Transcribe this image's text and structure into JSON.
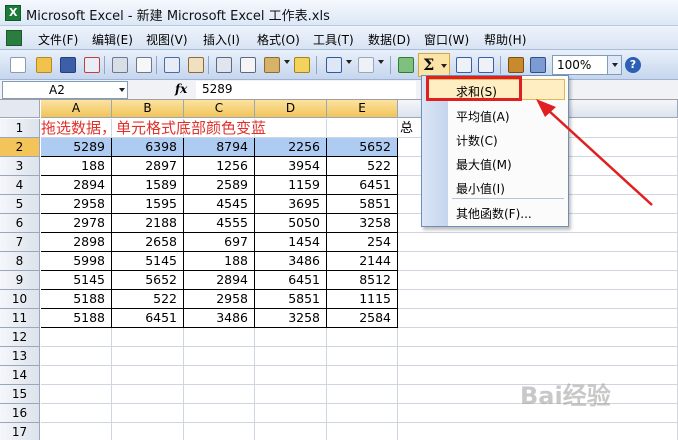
{
  "window": {
    "title": "Microsoft Excel - 新建 Microsoft Excel 工作表.xls"
  },
  "menubar": {
    "items": [
      "文件(F)",
      "编辑(E)",
      "视图(V)",
      "插入(I)",
      "格式(O)",
      "工具(T)",
      "数据(D)",
      "窗口(W)",
      "帮助(H)"
    ]
  },
  "toolbar": {
    "sum_symbol": "Σ",
    "zoom": "100%",
    "help_symbol": "?"
  },
  "formula_bar": {
    "cell_ref": "A2",
    "fx": "fx",
    "value": "5289"
  },
  "sheet": {
    "columns": [
      "A",
      "B",
      "C",
      "D",
      "E"
    ],
    "row_numbers": [
      "1",
      "2",
      "3",
      "4",
      "5",
      "6",
      "7",
      "8",
      "9",
      "10",
      "11",
      "12",
      "13",
      "14",
      "15",
      "16",
      "17"
    ],
    "title_text": "拖选数据，单元格式底部颜色变蓝",
    "sum_label": "总",
    "data_rows": [
      [
        "5289",
        "6398",
        "8794",
        "2256",
        "5652"
      ],
      [
        "188",
        "2897",
        "1256",
        "3954",
        "522"
      ],
      [
        "2894",
        "1589",
        "2589",
        "1159",
        "6451"
      ],
      [
        "2958",
        "1595",
        "4545",
        "3695",
        "5851"
      ],
      [
        "2978",
        "2188",
        "4555",
        "5050",
        "3258"
      ],
      [
        "2898",
        "2658",
        "697",
        "1454",
        "254"
      ],
      [
        "5998",
        "5145",
        "188",
        "3486",
        "2144"
      ],
      [
        "5145",
        "5652",
        "2894",
        "6451",
        "8512"
      ],
      [
        "5188",
        "522",
        "2958",
        "5851",
        "1115"
      ],
      [
        "5188",
        "6451",
        "3486",
        "3258",
        "2584"
      ]
    ],
    "selected_row": "2",
    "highlight_color": "#aecbf2"
  },
  "autosum_menu": {
    "items": [
      "求和(S)",
      "平均值(A)",
      "计数(C)",
      "最大值(M)",
      "最小值(I)",
      "其他函数(F)..."
    ]
  },
  "annotation": {
    "color": "#e02020"
  },
  "watermark": {
    "text": "Bai经验"
  }
}
